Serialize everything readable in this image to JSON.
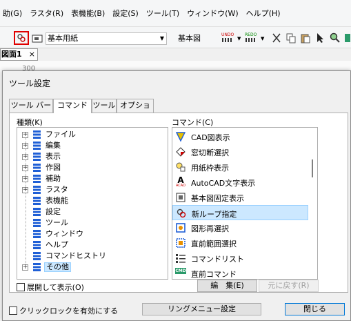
{
  "menubar": {
    "items": [
      "助(G)",
      "ラスタ(R)",
      "表機能(B)",
      "設定(S)",
      "ツール(T)",
      "ウィンドウ(W)",
      "ヘルプ(H)"
    ]
  },
  "toolbar": {
    "paper_select_value": "基本用紙",
    "base_drawing_label": "基本図",
    "undo_icon_text": "UNDO",
    "redo_icon_text": "REDO"
  },
  "document": {
    "tab_label": "図面1",
    "tab_close": "×",
    "ruler_value": "300"
  },
  "dialog": {
    "title": "ツール設定",
    "tabs": [
      "ツール バー",
      "コマンド",
      "ツール",
      "オプション"
    ],
    "active_tab": 1,
    "category_label": "種類(K)",
    "command_label": "コマンド(C)",
    "categories": [
      {
        "label": "ファイル",
        "expandable": true
      },
      {
        "label": "編集",
        "expandable": true
      },
      {
        "label": "表示",
        "expandable": true
      },
      {
        "label": "作図",
        "expandable": true
      },
      {
        "label": "補助",
        "expandable": true
      },
      {
        "label": "ラスタ",
        "expandable": true
      },
      {
        "label": "表機能",
        "expandable": false
      },
      {
        "label": "設定",
        "expandable": false
      },
      {
        "label": "ツール",
        "expandable": false
      },
      {
        "label": "ウィンドウ",
        "expandable": false
      },
      {
        "label": "ヘルプ",
        "expandable": false
      },
      {
        "label": "コマンドヒストリ",
        "expandable": false
      },
      {
        "label": "その他",
        "expandable": true
      }
    ],
    "selected_category": 12,
    "commands": [
      {
        "label": "CAD図表示",
        "icon": "cad-display-icon"
      },
      {
        "label": "窓切断選択",
        "icon": "window-cut-select-icon"
      },
      {
        "label": "用紙枠表示",
        "icon": "paper-frame-icon"
      },
      {
        "label": "AutoCAD文字表示",
        "icon": "autocad-text-icon",
        "icon_text": "A",
        "icon_subtext": "ACAD"
      },
      {
        "label": "基本図固定表示",
        "icon": "base-drawing-fixed-icon"
      },
      {
        "label": "新ループ指定",
        "icon": "new-loop-icon"
      },
      {
        "label": "図形再選択",
        "icon": "reselect-shape-icon"
      },
      {
        "label": "直前範囲選択",
        "icon": "previous-range-icon"
      },
      {
        "label": "コマンドリスト",
        "icon": "command-list-icon"
      },
      {
        "label": "直前コマンド",
        "icon": "previous-command-icon",
        "icon_text": "CMD"
      }
    ],
    "selected_command": 5,
    "expand_checkbox_label": "展開して表示(O)",
    "edit_button": "編　集(E)",
    "restore_button": "元に戻す(R)",
    "click_lock_label": "クリックロックを有効にする",
    "ring_menu_button": "リングメニュー設定",
    "close_button": "閉じる"
  },
  "colors": {
    "selection_bg": "#cce8ff",
    "selection_border": "#99d1ff",
    "tree_icon_blue": "#1f5fd6",
    "toolbar_highlight": "#e00000"
  }
}
